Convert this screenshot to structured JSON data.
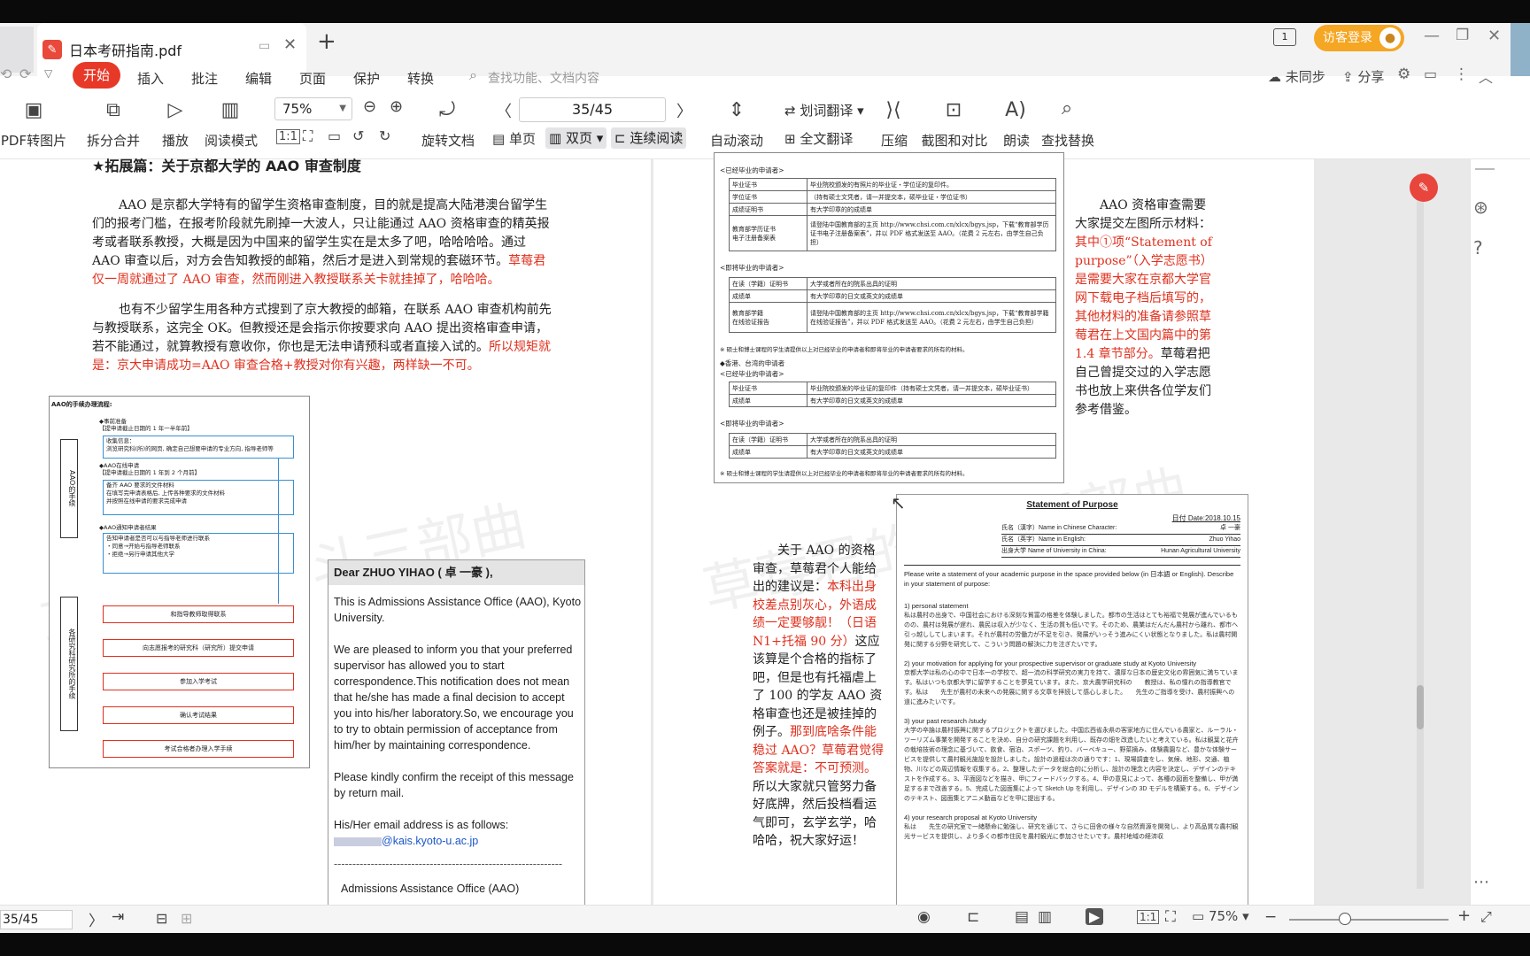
{
  "window": {
    "tab_title": "日本考研指南.pdf",
    "new_tab": "+",
    "login_label": "访客登录"
  },
  "menu": {
    "items": [
      "开始",
      "插入",
      "批注",
      "编辑",
      "页面",
      "保护",
      "转换"
    ],
    "search_placeholder": "查找功能、文档内容",
    "sync": "未同步",
    "share": "分享"
  },
  "toolbar": {
    "pdf_to_image": "PDF转图片",
    "split_merge": "拆分合并",
    "play": "播放",
    "read_mode": "阅读模式",
    "zoom": "75%",
    "page_input": "35/45",
    "rotate_doc": "旋转文档",
    "single_page": "单页",
    "double_page": "双页",
    "continuous": "连续阅读",
    "auto_scroll": "自动滚动",
    "word_translate": "划词翻译",
    "full_translate": "全文翻译",
    "compress": "压缩",
    "screenshot_compare": "截图和对比",
    "read_aloud": "朗读",
    "find_replace": "查找替换"
  },
  "left_page": {
    "heading": "★拓展篇：关于京都大学的 AAO 审查制度",
    "p1_black": "AAO 是京都大学特有的留学生资格审查制度，目的就是提高大陆港澳台留学生们的报考门槛，在报考阶段就先刷掉一大波人，只让能通过 AAO 资格审查的精英报考或者联系教授，大概是因为中国来的留学生实在是太多了吧，哈哈哈哈。通过 AAO 审查以后，对方会告知教授的邮箱，然后才是进入到常规的套磁环节。",
    "p1_red": "草莓君仅一周就通过了 AAO 审查，然而刚进入教授联系关卡就挂掉了，哈哈哈。",
    "p2_black": "也有不少留学生用各种方式搜到了京大教授的邮箱，在联系 AAO 审查机构前先与教授联系，这完全 OK。但教授还是会指示你按要求向 AAO 提出资格审查申请，若不能通过，就算教授有意收你，你也是无法申请预科或者直接入试的。",
    "p2_red": "所以规矩就是：京大申请成功=AAO 审查合格+教授对你有兴趣，两样缺一不可。",
    "flow_title": "AAO的手续办理流程:",
    "flow_side1": "AAO的手续",
    "flow_side2": "各研究科研究所的手续",
    "flow_items": [
      "◆事前准备\n【提申请截止日期的 1 年一半年前】",
      "收集信息：\n浏览研究科(所)的网页, 确定自己想要申请的专业方向, 指导老师等",
      "◆AAO在线申请\n【提申请截止日期的 1 年到 2 个月前】",
      "备齐 AAO 要求的文件材料\n在填写完申请表格后, 上传各种要求的文件材料\n并按照在线申请的要求完成申请",
      "◆AAO通知申请者结果",
      "告知申请者是否可以与指导老师进行联系\n・同意→开始与指导老师联系\n・拒绝→另行申请其他大学"
    ],
    "flow_red": [
      "和指导教师取得联系",
      "向志愿报考的研究科（研究所）提交申请",
      "参加入学考试",
      "确认考试结果",
      "考试合格者办理入学手续"
    ],
    "letter_greeting": "Dear ZHUO YIHAO ( 卓 一豪 ),",
    "letter_p1": "This is Admissions Assistance Office (AAO), Kyoto University.",
    "letter_p2": "We are pleased to inform you that your preferred supervisor has allowed you to start correspondence.This notification does not mean that he/she has made a final decision to accept you into his/her laboratory.So, we encourage you to try to obtain permission of acceptance from him/her by maintaining correspondence.",
    "letter_p3": "Please kindly confirm the receipt of this message by return mail.",
    "letter_p4": "His/Her email address is as follows:",
    "letter_email": "@kais.kyoto-u.ac.jp",
    "letter_sep": "--------------------------------------------------------------",
    "letter_sign": "Admissions Assistance Office (AAO)",
    "watermark": "草莓君的奋斗三部曲"
  },
  "right_page": {
    "graduated_label": "<已经毕业的申请者>",
    "table1": [
      [
        "毕业证书",
        "毕业院校颁发的有照片的毕业证・学位证的复印件。"
      ],
      [
        "学位证书",
        "（持有硕士文凭者，请一并提交本，硕毕业证・学位证书）"
      ],
      [
        "成绩证明书",
        "有大学印章的的成绩单"
      ],
      [
        "教育部学历证书\n电子注册备案表",
        "请登陆中国教育部的主页 http://www.chsi.com.cn/xlcx/bgys.jsp，下载“教育部学历证书电子注册备案表”，并以 PDF 格式发送至 AAO。（花费 2 元左右，由学生自己负担）"
      ]
    ],
    "upcoming_label": "<即将毕业的申请者>",
    "table2": [
      [
        "在读（学籍）证明书",
        "大学或者所在的院系出具的证明"
      ],
      [
        "成绩单",
        "有大学印章的日文或英文的成绩单"
      ],
      [
        "教育部学籍\n在线验证报告",
        "请登陆中国教育部的主页 http://www.chsi.com.cn/xlcx/bgys.jsp，下载“教育部学籍在线验证报告”，并以 PDF 格式发送至 AAO。（花费 2 元左右，由学生自己负担）"
      ]
    ],
    "note1": "※ 硕士和博士课程的学生请提供以上对已经毕业的申请者和即将毕业的申请者要求的所有的材料。",
    "hk_label": "◆香港、台湾的申请者",
    "hk_grad": "<已经毕业的申请者>",
    "table3": [
      [
        "毕业证书",
        "毕业院校颁发的毕业证的复印件（持有硕士文凭者，请一并提交本，硕毕业证书）"
      ],
      [
        "成绩单",
        "有大学印章的日文或英文的成绩单"
      ]
    ],
    "hk_up": "<即将毕业的申请者>",
    "table4": [
      [
        "在读（学籍）证明书",
        "大学或者所在的院系出具的证明"
      ],
      [
        "成绩单",
        "有大学印章的日文或英文的成绩单"
      ]
    ],
    "note2": "※ 硕士和博士课程的学生请提供以上对已经毕业的申请者和即将毕业的申请者要求的所有的材料。",
    "side_black1": "AAO 资格审查需要大家提交左图所示材料：",
    "side_red": "其中①项“Statement of purpose”（入学志愿书）是需要大家在京都大学官网下载电子档后填写的，其他材料的准备请参照草莓君在上文国内篇中的第 1.4 章节部分。",
    "side_black2": "草莓君把自己曾提交过的入学志愿书也放上来供各位学友们参考借鉴。",
    "adv_black1": "关于 AAO 的资格审查，草莓君个人能给出的建议是：",
    "adv_red1": "本科出身校差点别灰心，外语成绩一定要够靓！（日语 N1+托福 90 分）",
    "adv_black2": "这应该算是个合格的指标了吧，但是也有托福虐上了 100 的学友 AAO 资格审查也还是被挂掉的例子。",
    "adv_red2": "那到底啥条件能稳过 AAO？草莓君觉得答案就是：不可预测。",
    "adv_black3": "所以大家就只管努力备好底牌，然后投档看运气即可，玄学玄学，哈哈哈，祝大家好运！",
    "sop_title": "Statement of Purpose",
    "sop_date": "日付 Date:2018.10.15",
    "sop_fields": [
      [
        "氏名（漢字）Name in Chinese Character:",
        "卓 一豪"
      ],
      [
        "氏名（英字）Name in English:",
        "Zhuo Yihao"
      ],
      [
        "出身大学  Name of University in China:",
        "Hunan Agricultural University"
      ]
    ],
    "sop_instr": "Please write a statement of your academic purpose in the space provided below (in 日本語 or English). Describe in your statement of purpose:",
    "sop_s1": "1) personal statement",
    "sop_t1": "私は農村の出身で、中国社会における深刻な貧富の格差を体験しました。都市の生活はとても裕福で発展が進んでいるものの、農村は発展が遅れ、農民は収入が少なく、生活の質も低いです。そのため、農業はだんだん農村から離れ、都市へ引っ越ししてしまいます。それが農村の労働力が不足を引き、発展がいっそう進みにくい状態となりました。私は農村開発に関する分野を研究して、こういう問題の解決に力を注ぎたいです。",
    "sop_s2": "2) your motivation for applying for your prospective supervisor or graduate study at Kyoto University",
    "sop_t2": "京都大学は私の心の中で日本一の学校で、超一流の科学研究の実力を持て、濃厚な日本の歴史文化の雰囲気に満ちています。私はいつも京都大学に留学することを夢見ています。また、京大農学研究科の　　教授は、私の憧れの指導教官です。私は　　先生が農村の未来への発展に関する文章を拝読して感心しました。　　先生のご指導を受け、農村振興への道に進みたいです。",
    "sop_s3": "3) your past research /study",
    "sop_t3": "大学の卒論は農村振興に関するプロジェクトを選びました。中国広西省永県の客家地方に住んでいる農家と、ルーラル・ツーリズム事業を開発することを決め、自分の研究課題を利用し、既存の畑を改造したいと考えている。私は観葉と花卉の栽培技術の理念に基づいて、飲食、宿泊、スポーツ、釣り、バーベキュー、野菜摘み、体験農園など、豊かな体験サービスを提供して農村観光施設を設計しました。設計の過程は次の通りです：1、現場調査をし、気候、地形、交通、植物、川などの周辺情報を収集する。2、整理したデータを総合的に分析し、設計の理念と内容を決定し、デザインのテキストを作成する。3、平面図などを描き、甲にフィードバックする。4、甲の意見によって、各種の図面を整備し、甲が満足するまで改善する。5、完成した図面集によって Sketch Up を利用し、デザインの 3D モデルを構築する。6、デザインのテキスト、図面集とアニメ動画などを甲に提出する。",
    "sop_s4": "4) your research proposal at Kyoto University",
    "sop_t4": "私は　　先生の研究室で一緒懸命に勉強し、研究を通じて、さらに田舎の様々な自然資源を開発し、より高品質な農村観光サービスを提供し、より多くの都市住民を農村観光に参加させたいです。農村地域の経済収"
  },
  "statusbar": {
    "page": "35/45",
    "zoom": "75%"
  },
  "colors": {
    "accent_red": "#e0301e",
    "menu_active": "#e83828",
    "login_orange": "#f5a623"
  }
}
